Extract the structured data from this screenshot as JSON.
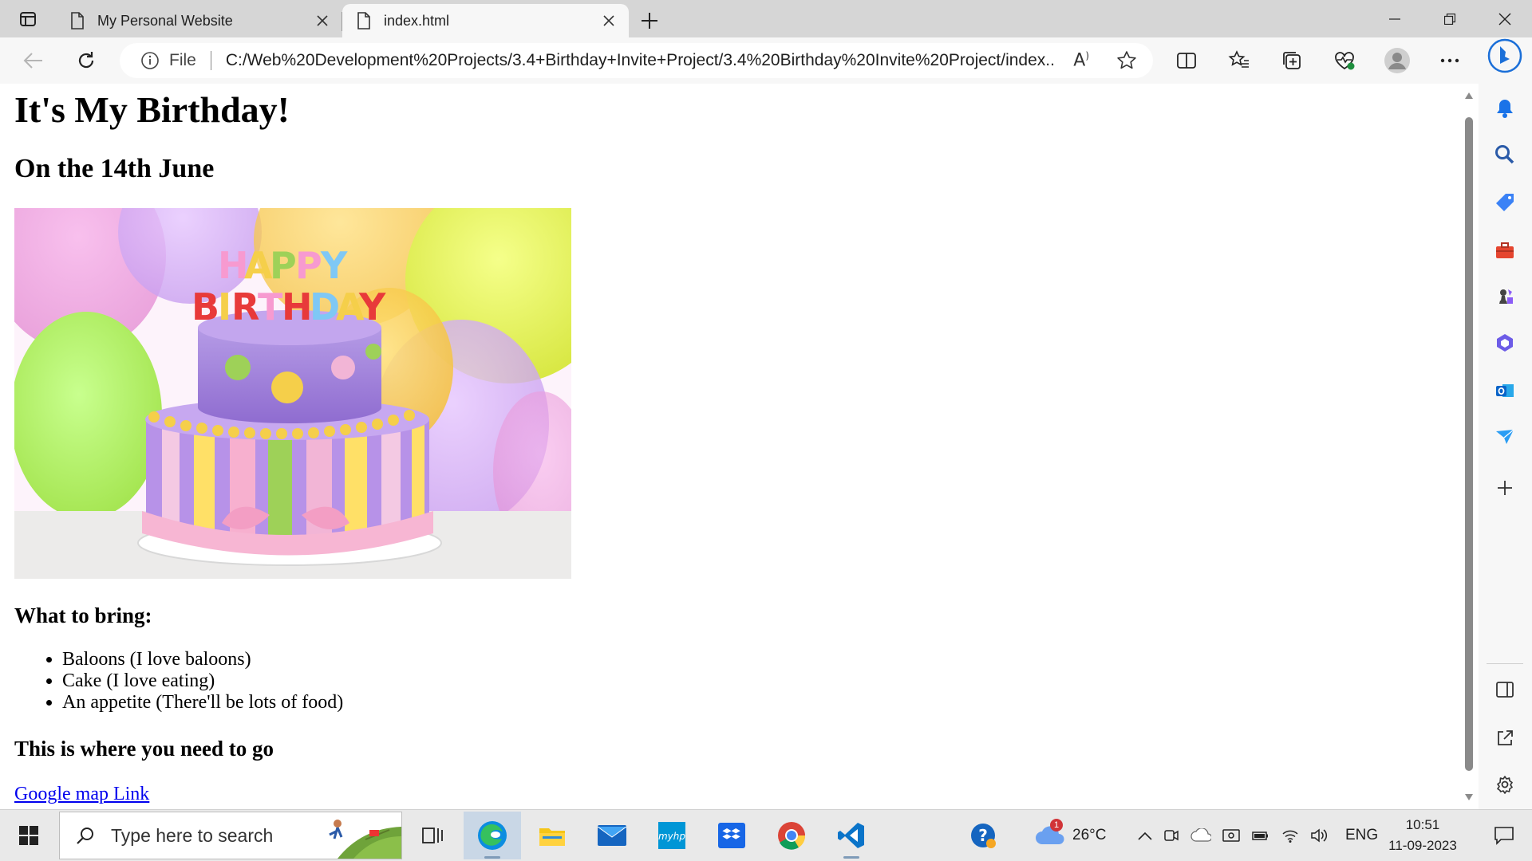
{
  "browser": {
    "tabs": [
      {
        "title": "My Personal Website",
        "active": false
      },
      {
        "title": "index.html",
        "active": true
      }
    ],
    "address": {
      "scheme_label": "File",
      "url": "C:/Web%20Development%20Projects/3.4+Birthday+Invite+Project/3.4%20Birthday%20Invite%20Project/index..."
    }
  },
  "page": {
    "heading": "It's My Birthday!",
    "date": "On the 14th June",
    "cake_caption": "HAPPY BIRTHDAY",
    "bring_title": "What to bring:",
    "bring_items": [
      "Baloons (I love baloons)",
      "Cake (I love eating)",
      "An appetite (There'll be lots of food)"
    ],
    "directions_title": "This is where you need to go",
    "map_link": "Google map Link"
  },
  "taskbar": {
    "search_placeholder": "Type here to search",
    "weather": "26°C",
    "weather_badge": "1",
    "language": "ENG",
    "time": "10:51",
    "date": "11-09-2023"
  },
  "colors": {
    "link": "#0000ee",
    "edge_blue": "#0c59a4"
  }
}
